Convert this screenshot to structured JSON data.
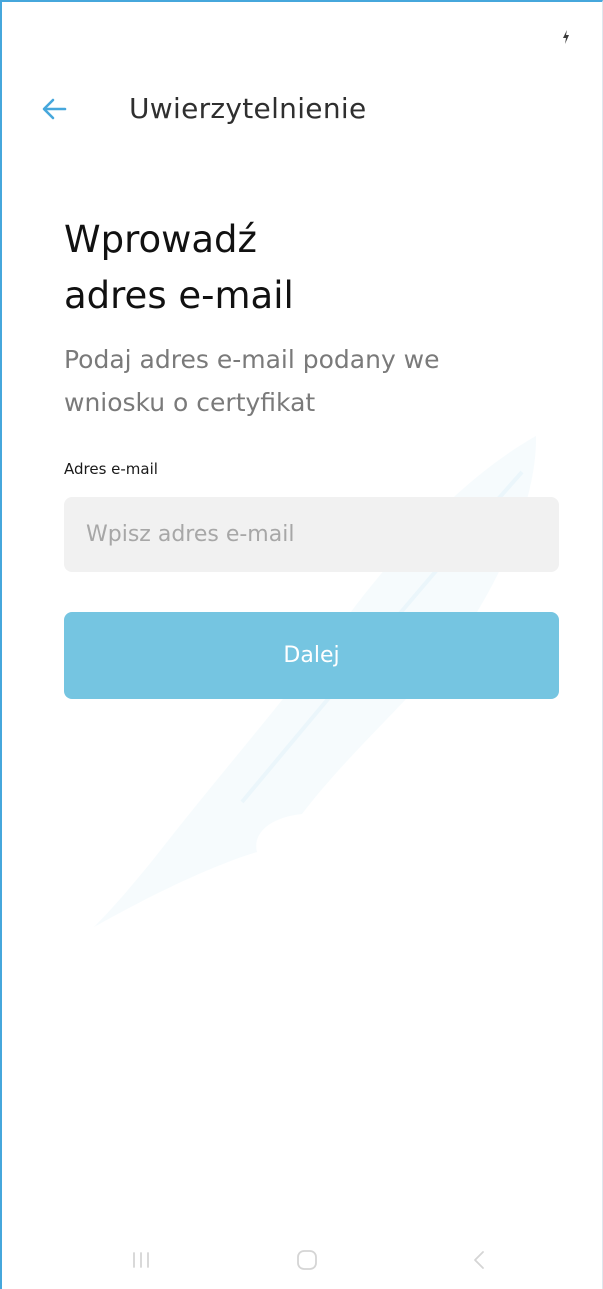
{
  "header": {
    "title": "Uwierzytelnienie",
    "back_icon": "arrow-left-icon"
  },
  "main": {
    "heading_line1": "Wprowadź",
    "heading_line2": "adres e-mail",
    "subtitle_line1": "Podaj adres e-mail podany we",
    "subtitle_line2": "wniosku o certyfikat"
  },
  "form": {
    "email_label": "Adres e-mail",
    "email_placeholder": "Wpisz adres e-mail",
    "email_value": "",
    "next_label": "Dalej"
  },
  "status_bar": {
    "battery_icon": "battery-charging-icon"
  },
  "nav_bar": {
    "recent_icon": "recent-apps-icon",
    "home_icon": "home-icon",
    "back_icon": "back-icon"
  },
  "colors": {
    "accent": "#46a7dc",
    "button": "#75c5e1",
    "field_background": "#f1f1f1",
    "subtitle": "#7a7a7a"
  }
}
